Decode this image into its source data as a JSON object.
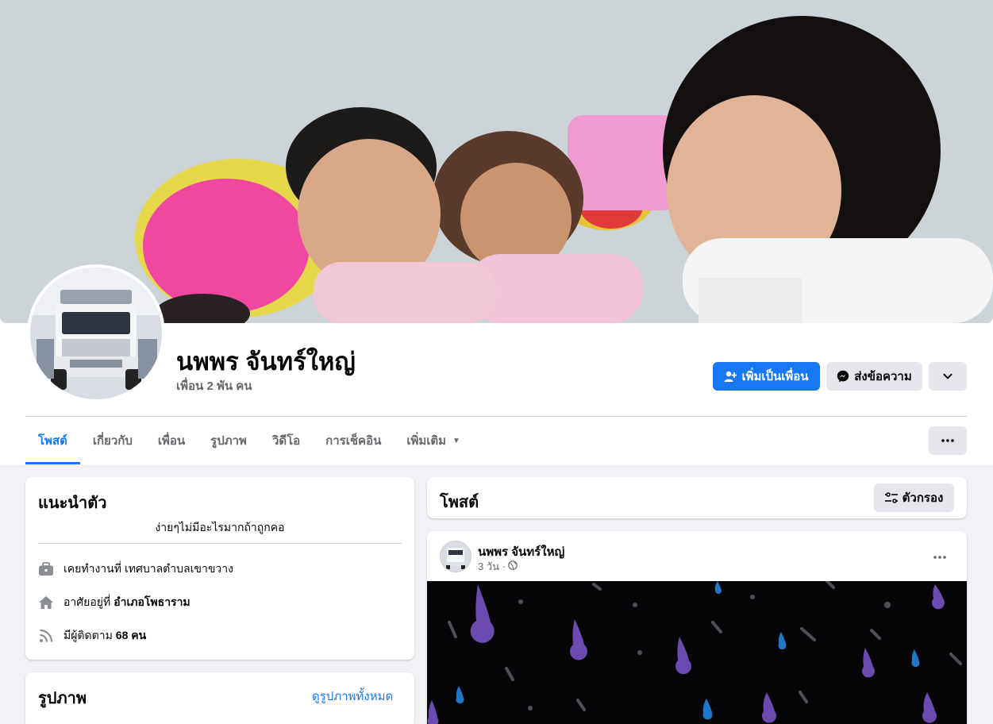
{
  "profile": {
    "name": "นพพร จันทร์ใหญ่",
    "friends": "เพื่อน 2 พัน คน"
  },
  "actions": {
    "add_friend": "เพิ่มเป็นเพื่อน",
    "message": "ส่งข้อความ"
  },
  "tabs": [
    {
      "label": "โพสต์",
      "active": true
    },
    {
      "label": "เกี่ยวกับ",
      "active": false
    },
    {
      "label": "เพื่อน",
      "active": false
    },
    {
      "label": "รูปภาพ",
      "active": false
    },
    {
      "label": "วิดีโอ",
      "active": false
    },
    {
      "label": "การเช็คอิน",
      "active": false
    },
    {
      "label": "เพิ่มเติม",
      "active": false
    }
  ],
  "intro": {
    "title": "แนะนำตัว",
    "bio": "ง่ายๆไม่มีอะไรมากถ้าถูกคอ",
    "work_prefix": "เคยทำงานที่",
    "work_value": "เทศบาลตำบลเขาขวาง",
    "live_prefix": "อาศัยอยู่ที่",
    "live_value": "อำเภอโพธาราม",
    "followers_prefix": "มีผู้ติดตาม",
    "followers_value": "68 คน"
  },
  "photos": {
    "title": "รูปภาพ",
    "see_all": "ดูรูปภาพทั้งหมด"
  },
  "posts": {
    "title": "โพสต์",
    "filter_label": "ตัวกรอง",
    "items": [
      {
        "author": "นพพร จันทร์ใหญ่",
        "time": "3 วัน ·"
      }
    ]
  },
  "colors": {
    "accent": "#1877f2",
    "background": "#f0f2f5",
    "secondary_button": "#e4e6eb",
    "muted_text": "#65676b"
  }
}
